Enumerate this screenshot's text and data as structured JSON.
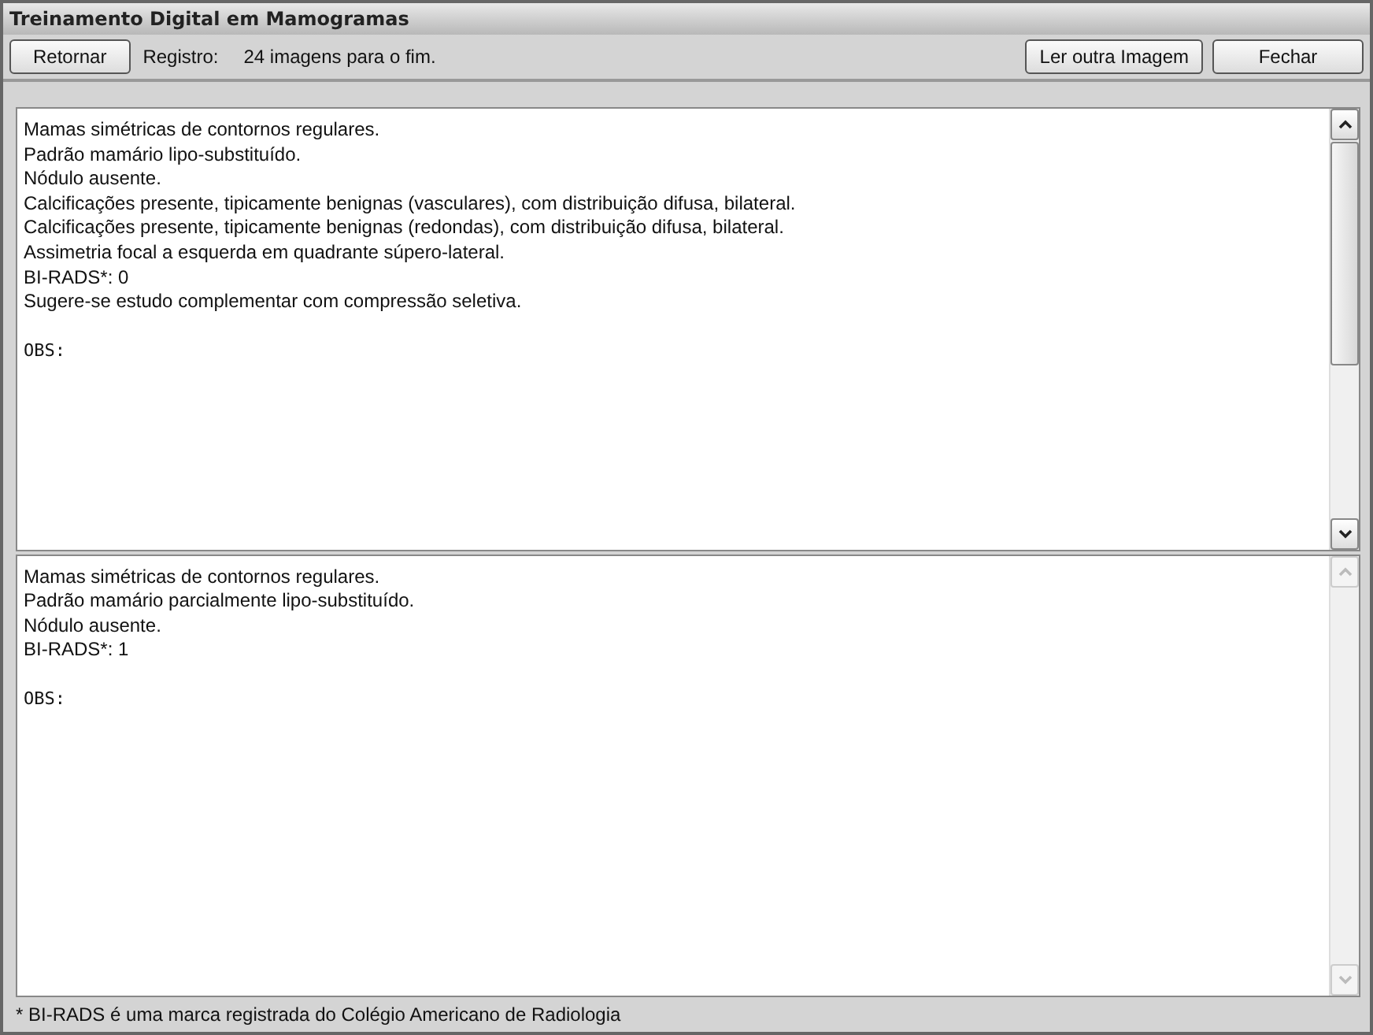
{
  "window": {
    "title": "Treinamento Digital em Mamogramas"
  },
  "toolbar": {
    "left_buttons": [
      "Retornar"
    ],
    "registro_label": "Registro:",
    "registro_value": "24 imagens para o fim.",
    "right_buttons": [
      "Ler outra Imagem",
      "Fechar"
    ]
  },
  "panels": [
    {
      "lines": [
        "Mamas simétricas de contornos regulares.",
        "Padrão mamário lipo-substituído.",
        "Nódulo ausente.",
        "Calcificações presente, tipicamente benignas (vasculares), com distribuição difusa, bilateral.",
        "Calcificações presente, tipicamente benignas (redondas), com distribuição difusa, bilateral.",
        "Assimetria focal a esquerda em quadrante súpero-lateral.",
        "BI-RADS*: 0",
        "Sugere-se estudo complementar com compressão seletiva."
      ],
      "obs": "OBS:",
      "scrollbar_disabled": false
    },
    {
      "lines": [
        "Mamas simétricas de contornos regulares.",
        "Padrão mamário parcialmente lipo-substituído.",
        "Nódulo ausente.",
        "BI-RADS*: 1"
      ],
      "obs": "OBS:",
      "scrollbar_disabled": true
    }
  ],
  "footnote": "* BI-RADS é uma marca registrada do Colégio Americano de Radiologia"
}
